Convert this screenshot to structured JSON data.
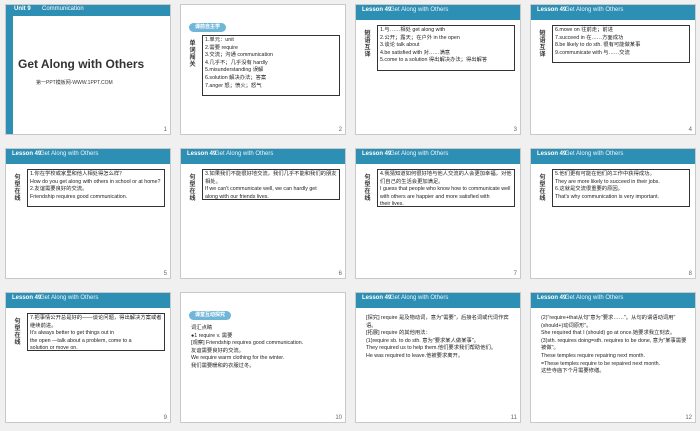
{
  "slides": [
    {
      "n": "1",
      "unit": "Unit 9",
      "topic": "Communication",
      "title": "Get Along with Others",
      "site": "第一PPT模板网-WWW.1PPT.COM"
    },
    {
      "n": "2",
      "pill": "课前自主学",
      "side": "单词闯关",
      "lines": [
        "1.单元：unit",
        "2.需要 require",
        "3.交流；沟通 communication",
        "4.几乎不；几乎没有 hardly",
        "5.misunderstanding 误解",
        "6.solution 解决办法；答案",
        "7.anger 怒；愤火；怒气"
      ]
    },
    {
      "n": "3",
      "lesson": "Lesson 49",
      "topic": "Get Along with Others",
      "side": "短语互译",
      "lines": [
        "1.与……相处 get along with",
        "2.公开；露天；在户外 in the open",
        "3.谈论 talk about",
        "4.be satisfied with 对……满意",
        "5.come to a solution 得出解决办法；得出解答"
      ]
    },
    {
      "n": "4",
      "lesson": "Lesson 49",
      "topic": "Get Along with Others",
      "side": "短语互译",
      "lines": [
        "6.move on 往前走；前进",
        "7.succeed in 在……方面成功",
        "8.be likely to do sth. 很有可能做某事",
        "9.communicate with 与……交流"
      ]
    },
    {
      "n": "5",
      "lesson": "Lesson 49",
      "topic": "Get Along with Others",
      "side": "句型在线",
      "lines": [
        "1.你在学校或家里和他人相处得怎么样？",
        "How do you get along with others in school or at home?",
        "2.友谊需要良好的交流。",
        "Friendship requires good communication."
      ]
    },
    {
      "n": "6",
      "lesson": "Lesson 49",
      "topic": "Get Along with Others",
      "side": "句型在线",
      "lines": [
        "3.如果我们不能很好地交流，我们几乎不能和我们的朋友相处。",
        "If we can't communicate well, we can hardly get",
        "along with our friends lives."
      ]
    },
    {
      "n": "7",
      "lesson": "Lesson 49",
      "topic": "Get Along with Others",
      "side": "句型在线",
      "lines": [
        "4.我猜知道如何很好地与他人交流的人会更加幸福，对他们自己的生活会更加满足。",
        "I guess that people who know how to communicate well",
        "with others are happier and more satisfied with",
        "their lives."
      ]
    },
    {
      "n": "8",
      "lesson": "Lesson 49",
      "topic": "Get Along with Others",
      "side": "句型在线",
      "lines": [
        "5.他们更有可能在他们的工作中获得成功。",
        "They are more likely to succeed in their jobs.",
        "6.这就是交流很重要的原因。",
        "That's why communication is very important."
      ]
    },
    {
      "n": "9",
      "lesson": "Lesson 49",
      "topic": "Get Along with Others",
      "side": "句型在线",
      "lines": [
        "7.把事情公开总是好的——谈论问题，得出解决方案或者继续前进。",
        "It's always better to get things out in",
        "the open —talk about a problem, come to a",
        "solution or move on."
      ]
    },
    {
      "n": "10",
      "pill": "课堂互动探究",
      "lines": [
        "词汇点睛",
        "●1 require v. 需要",
        "[观察] Friendship requires good communication.",
        "友谊需要良好的交流。",
        "We require warm clothing for the winter.",
        "我们需要暖和的衣服过冬。"
      ]
    },
    {
      "n": "11",
      "lesson": "Lesson 49",
      "topic": "Get Along with Others",
      "lines": [
        "[探究] require 是及物动词，意为\"需要\"，后接名词或代词作宾语。",
        "[拓展] require 的其他用法：",
        "(1)require sb. to do sth. 意为\"要求某人做某事\"。",
        "They required us to help them.他们要求我们帮助他们。",
        "He was required to leave.他被要求离开。"
      ]
    },
    {
      "n": "12",
      "lesson": "Lesson 49",
      "topic": "Get Along with Others",
      "lines": [
        "(2)\"require+that从句\"意为\"要求……\"。从句的谓语动词用\"(should+)动词原形\"。",
        "She required that I (should) go at once.她要求我立刻去。",
        "(3)sth. requires doing=sth. requires to be done, 意为\"某事需要被做\"。",
        "These temples require repairing next month.",
        "=These temples require to be repaired next month.",
        "这些寺庙下个月需要修缮。"
      ]
    }
  ]
}
